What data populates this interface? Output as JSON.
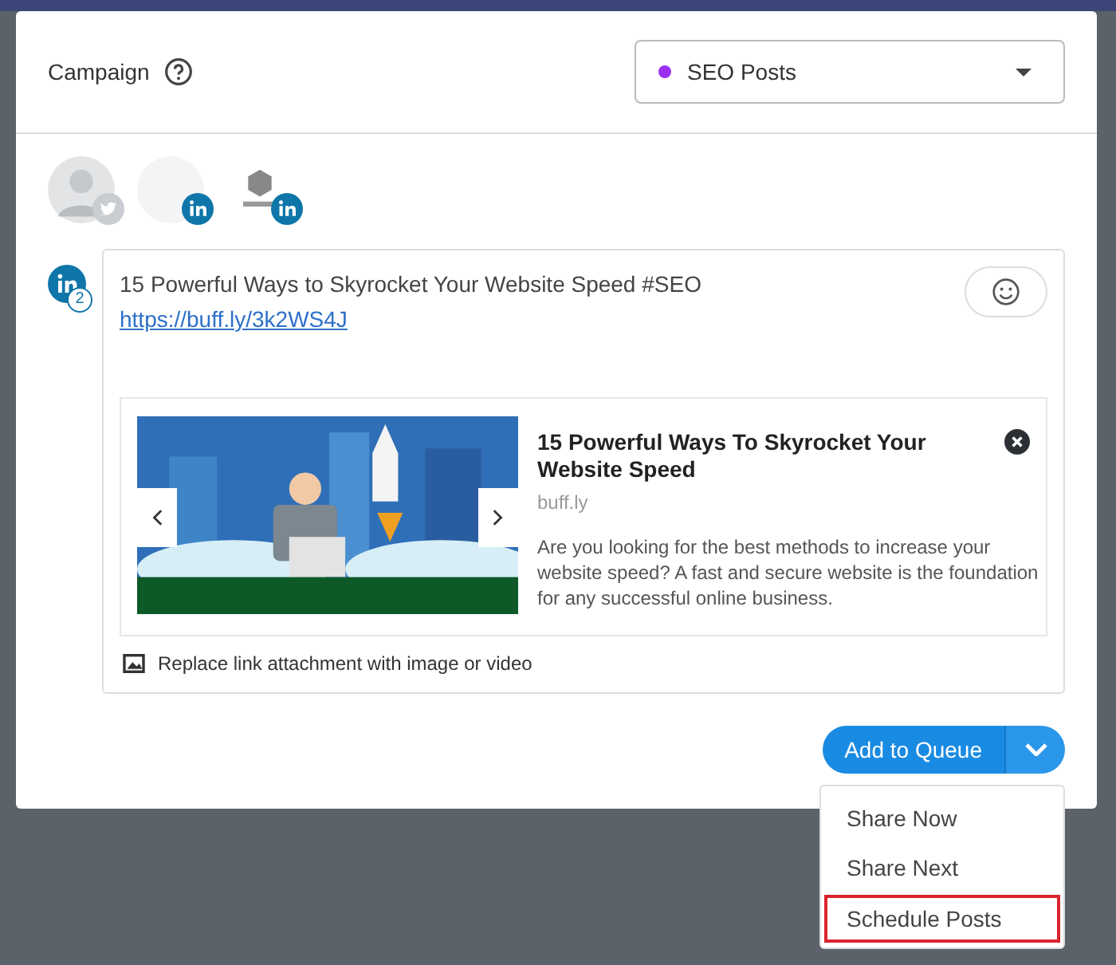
{
  "campaign": {
    "label": "Campaign",
    "value": "SEO Posts",
    "color": "#9b30f2"
  },
  "profiles": [
    {
      "kind": "twitter"
    },
    {
      "kind": "linkedin"
    },
    {
      "kind": "linkedin"
    }
  ],
  "composer": {
    "count": "2",
    "text": "15 Powerful Ways to Skyrocket Your Website Speed #SEO",
    "link": "https://buff.ly/3k2WS4J"
  },
  "preview": {
    "title": "15 Powerful Ways To Skyrocket Your Website Speed",
    "domain": "buff.ly",
    "description": "Are you looking for the best methods to increase your website speed? A fast and secure website is the foundation for any successful online business."
  },
  "attachment": "Replace link attachment with image or video",
  "actions": {
    "primary": "Add to Queue",
    "menu": [
      {
        "label": "Share Now",
        "highlighted": false
      },
      {
        "label": "Share Next",
        "highlighted": false
      },
      {
        "label": "Schedule Posts",
        "highlighted": true
      }
    ]
  }
}
